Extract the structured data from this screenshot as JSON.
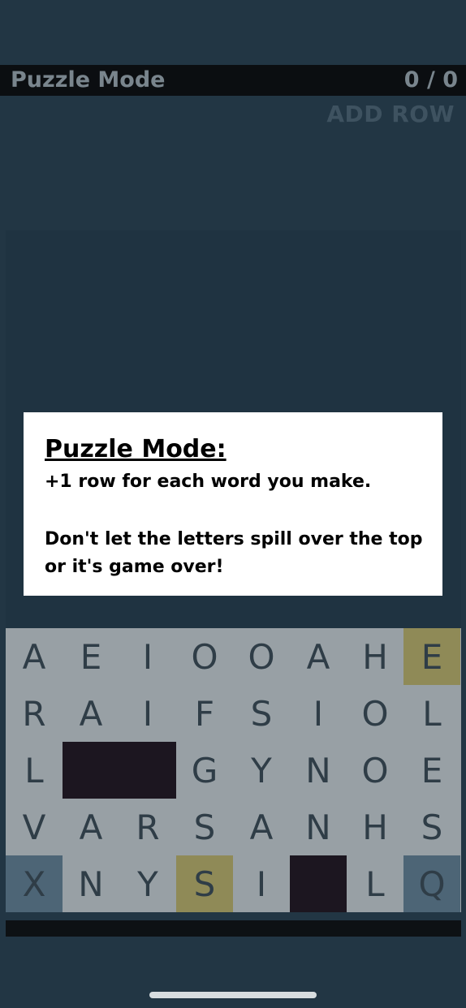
{
  "header": {
    "title": "Puzzle Mode",
    "score": "0 / 0"
  },
  "add_row_label": "ADD ROW",
  "modal": {
    "title": "Puzzle Mode:",
    "line1": "+1 row for each word you make.",
    "line2": "Don't let the letters spill over the top or it's game over!"
  },
  "grid": {
    "rows": [
      [
        "A",
        "E",
        "I",
        "O",
        "O",
        "A",
        "H",
        "E"
      ],
      [
        "R",
        "A",
        "I",
        "F",
        "S",
        "I",
        "O",
        "L"
      ],
      [
        "L",
        "",
        "",
        "G",
        "Y",
        "N",
        "O",
        "E"
      ],
      [
        "V",
        "A",
        "R",
        "S",
        "A",
        "N",
        "H",
        "S"
      ],
      [
        "X",
        "N",
        "Y",
        "S",
        "I",
        "",
        "L",
        "Q"
      ]
    ],
    "highlights": [
      [
        0,
        0,
        0,
        0,
        0,
        0,
        0,
        "yellow"
      ],
      [
        0,
        0,
        0,
        0,
        0,
        0,
        0,
        0
      ],
      [
        0,
        "black",
        "black",
        0,
        0,
        0,
        0,
        0
      ],
      [
        0,
        0,
        0,
        0,
        0,
        0,
        0,
        0
      ],
      [
        "blue",
        0,
        0,
        "yellow",
        0,
        "black",
        0,
        "blue"
      ]
    ]
  }
}
